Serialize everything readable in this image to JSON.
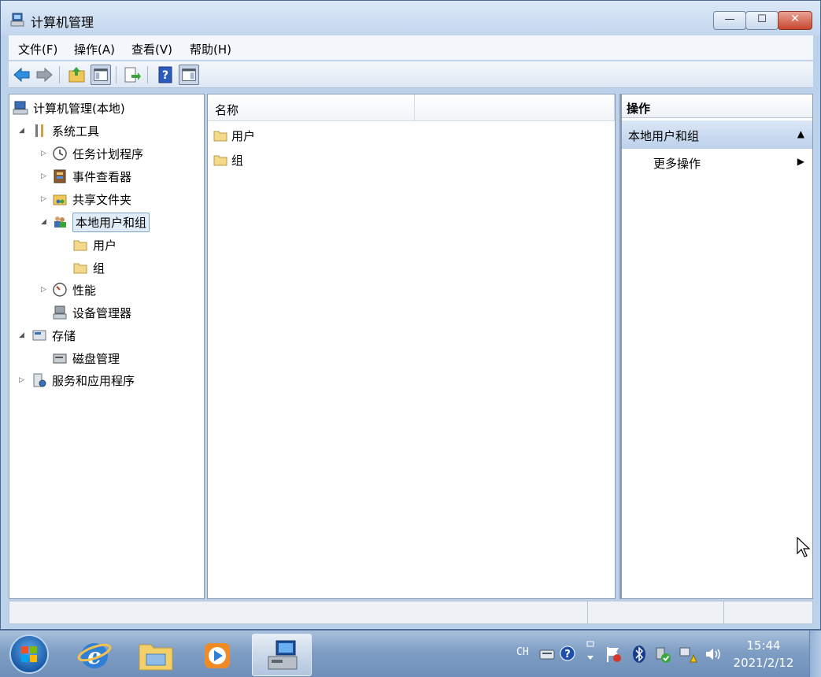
{
  "window": {
    "title": "计算机管理",
    "min_glyph": "—",
    "max_glyph": "☐",
    "close_glyph": "✕"
  },
  "menu": [
    "文件(F)",
    "操作(A)",
    "查看(V)",
    "帮助(H)"
  ],
  "toolbar": {
    "items": [
      "back-icon",
      "forward-icon",
      "up-folder-icon",
      "show-hide-tree-icon",
      "export-list-icon",
      "help-icon",
      "show-hide-action-pane-icon"
    ]
  },
  "tree": {
    "root": "计算机管理(本地)",
    "system_tools": "系统工具",
    "task_scheduler": "任务计划程序",
    "event_viewer": "事件查看器",
    "shared_folders": "共享文件夹",
    "local_users_groups": "本地用户和组",
    "users": "用户",
    "groups": "组",
    "performance": "性能",
    "device_manager": "设备管理器",
    "storage": "存储",
    "disk_management": "磁盘管理",
    "services_apps": "服务和应用程序"
  },
  "list": {
    "column_name": "名称",
    "rows": [
      "用户",
      "组"
    ]
  },
  "actions": {
    "header": "操作",
    "section": "本地用户和组",
    "more": "更多操作"
  },
  "taskbar": {
    "lang": "CH",
    "time": "15:44",
    "date": "2021/2/12"
  },
  "colors": {
    "window_frame": "#bcd1ea",
    "selection": "#e1ecf9",
    "close_button": "#c8462f",
    "action_section": "#bcd1ea"
  }
}
